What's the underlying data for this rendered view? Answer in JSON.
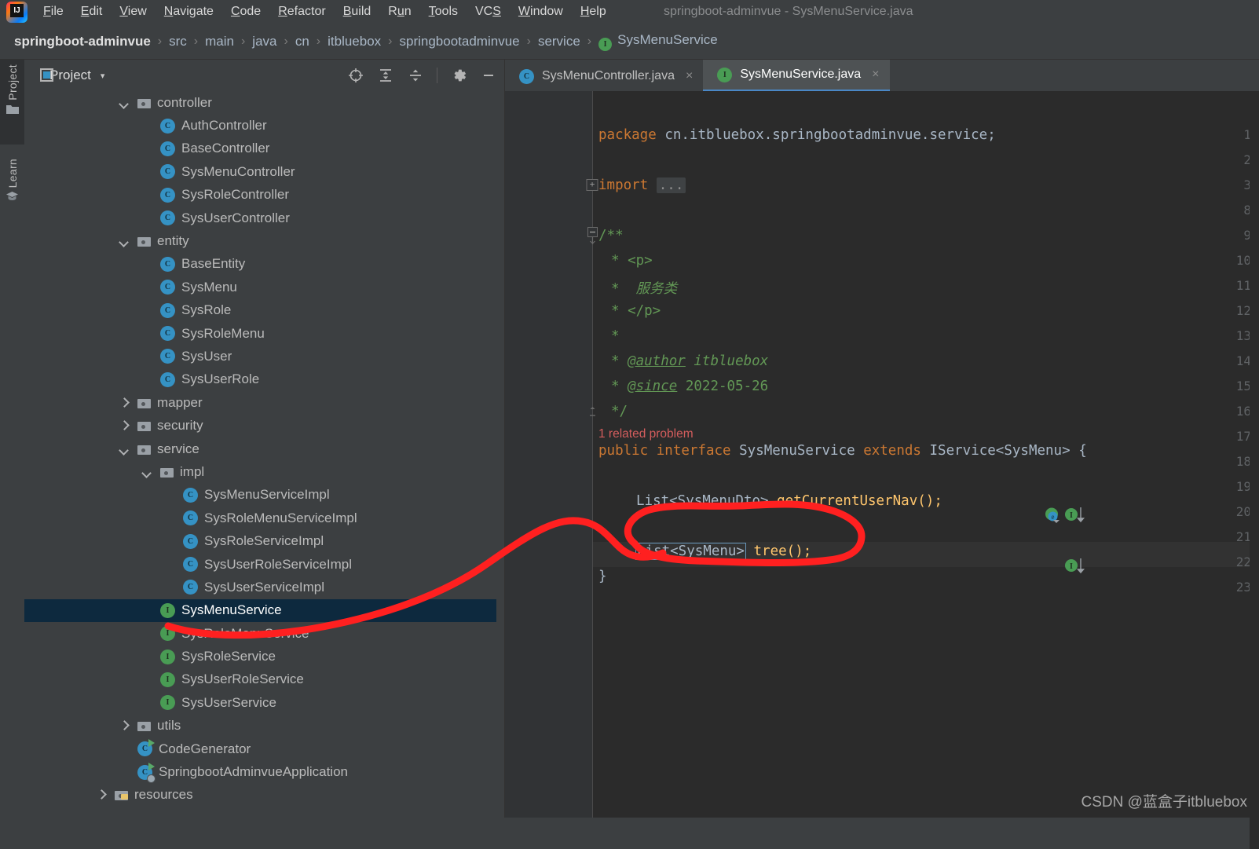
{
  "window": {
    "title": "springboot-adminvue - SysMenuService.java",
    "logo_text": "IJ",
    "logo_name": "intellij-idea-logo"
  },
  "menubar": {
    "items": [
      {
        "label": "File",
        "mnemonic": "F"
      },
      {
        "label": "Edit",
        "mnemonic": "E"
      },
      {
        "label": "View",
        "mnemonic": "V"
      },
      {
        "label": "Navigate",
        "mnemonic": "N"
      },
      {
        "label": "Code",
        "mnemonic": "C"
      },
      {
        "label": "Refactor",
        "mnemonic": "R"
      },
      {
        "label": "Build",
        "mnemonic": "B"
      },
      {
        "label": "Run",
        "mnemonic": "u"
      },
      {
        "label": "Tools",
        "mnemonic": "T"
      },
      {
        "label": "VCS",
        "mnemonic": "S"
      },
      {
        "label": "Window",
        "mnemonic": "W"
      },
      {
        "label": "Help",
        "mnemonic": "H"
      }
    ]
  },
  "breadcrumb": {
    "separator": "›",
    "items": [
      {
        "label": "springboot-adminvue",
        "icon": null
      },
      {
        "label": "src",
        "icon": null
      },
      {
        "label": "main",
        "icon": null
      },
      {
        "label": "java",
        "icon": null
      },
      {
        "label": "cn",
        "icon": null
      },
      {
        "label": "itbluebox",
        "icon": null
      },
      {
        "label": "springbootadminvue",
        "icon": null
      },
      {
        "label": "service",
        "icon": null
      },
      {
        "label": "SysMenuService",
        "icon": "I"
      }
    ]
  },
  "rail": {
    "buttons": [
      {
        "label": "Project",
        "icon": "folder-icon",
        "active": true
      },
      {
        "label": "Learn",
        "icon": "graduation-cap-icon",
        "active": false
      }
    ]
  },
  "project_panel": {
    "title": "Project",
    "caret": "▾",
    "toolbar_icons": [
      {
        "name": "locate-target-icon",
        "title": "Select Opened File"
      },
      {
        "name": "expand-all-icon",
        "title": "Expand All"
      },
      {
        "name": "collapse-all-icon",
        "title": "Collapse All"
      },
      {
        "name": "gear-icon",
        "title": "Options"
      },
      {
        "name": "minimize-icon",
        "title": "Hide"
      }
    ],
    "tree": [
      {
        "label": "controller",
        "type": "folder",
        "indent": 4,
        "arrow": "down"
      },
      {
        "label": "AuthController",
        "type": "class",
        "indent": 5,
        "arrow": "none"
      },
      {
        "label": "BaseController",
        "type": "class",
        "indent": 5,
        "arrow": "none"
      },
      {
        "label": "SysMenuController",
        "type": "class",
        "indent": 5,
        "arrow": "none"
      },
      {
        "label": "SysRoleController",
        "type": "class",
        "indent": 5,
        "arrow": "none"
      },
      {
        "label": "SysUserController",
        "type": "class",
        "indent": 5,
        "arrow": "none"
      },
      {
        "label": "entity",
        "type": "folder",
        "indent": 4,
        "arrow": "down"
      },
      {
        "label": "BaseEntity",
        "type": "class",
        "indent": 5,
        "arrow": "none"
      },
      {
        "label": "SysMenu",
        "type": "class",
        "indent": 5,
        "arrow": "none"
      },
      {
        "label": "SysRole",
        "type": "class",
        "indent": 5,
        "arrow": "none"
      },
      {
        "label": "SysRoleMenu",
        "type": "class",
        "indent": 5,
        "arrow": "none"
      },
      {
        "label": "SysUser",
        "type": "class",
        "indent": 5,
        "arrow": "none"
      },
      {
        "label": "SysUserRole",
        "type": "class",
        "indent": 5,
        "arrow": "none"
      },
      {
        "label": "mapper",
        "type": "folder",
        "indent": 4,
        "arrow": "right"
      },
      {
        "label": "security",
        "type": "folder",
        "indent": 4,
        "arrow": "right"
      },
      {
        "label": "service",
        "type": "folder",
        "indent": 4,
        "arrow": "down"
      },
      {
        "label": "impl",
        "type": "folder",
        "indent": 5,
        "arrow": "down"
      },
      {
        "label": "SysMenuServiceImpl",
        "type": "class",
        "indent": 6,
        "arrow": "none"
      },
      {
        "label": "SysRoleMenuServiceImpl",
        "type": "class",
        "indent": 6,
        "arrow": "none"
      },
      {
        "label": "SysRoleServiceImpl",
        "type": "class",
        "indent": 6,
        "arrow": "none"
      },
      {
        "label": "SysUserRoleServiceImpl",
        "type": "class",
        "indent": 6,
        "arrow": "none"
      },
      {
        "label": "SysUserServiceImpl",
        "type": "class",
        "indent": 6,
        "arrow": "none"
      },
      {
        "label": "SysMenuService",
        "type": "interface",
        "indent": 5,
        "arrow": "none",
        "selected": true
      },
      {
        "label": "SysRoleMenuService",
        "type": "interface",
        "indent": 5,
        "arrow": "none"
      },
      {
        "label": "SysRoleService",
        "type": "interface",
        "indent": 5,
        "arrow": "none"
      },
      {
        "label": "SysUserRoleService",
        "type": "interface",
        "indent": 5,
        "arrow": "none"
      },
      {
        "label": "SysUserService",
        "type": "interface",
        "indent": 5,
        "arrow": "none"
      },
      {
        "label": "utils",
        "type": "folder",
        "indent": 4,
        "arrow": "right"
      },
      {
        "label": "CodeGenerator",
        "type": "class-run",
        "indent": 4,
        "arrow": "none"
      },
      {
        "label": "SpringbootAdminvueApplication",
        "type": "class-runapp",
        "indent": 4,
        "arrow": "none"
      },
      {
        "label": "resources",
        "type": "folder-resources",
        "indent": 3,
        "arrow": "right"
      }
    ]
  },
  "editor": {
    "tabs": [
      {
        "label": "SysMenuController.java",
        "icon": "C",
        "active": false,
        "close": "×"
      },
      {
        "label": "SysMenuService.java",
        "icon": "I",
        "active": true,
        "close": "×"
      }
    ],
    "inspection_hint": "1 related problem",
    "line_numbers": [
      "1",
      "2",
      "3",
      "8",
      "9",
      "10",
      "11",
      "12",
      "13",
      "14",
      "15",
      "16",
      "17",
      "18",
      "19",
      "20",
      "21",
      "22",
      "23"
    ],
    "lines": [
      {
        "num": "1",
        "text": "package cn.itbluebox.springbootadminvue.service;"
      },
      {
        "num": "2",
        "text": ""
      },
      {
        "num": "3",
        "text": "import ..."
      },
      {
        "num": "8",
        "text": ""
      },
      {
        "num": "9",
        "text": "/**"
      },
      {
        "num": "10",
        "text": " * <p>"
      },
      {
        "num": "11",
        "text": " *  服务类"
      },
      {
        "num": "12",
        "text": " * </p>"
      },
      {
        "num": "13",
        "text": " *"
      },
      {
        "num": "14",
        "text": " * @author itbluebox"
      },
      {
        "num": "15",
        "text": " * @since 2022-05-26"
      },
      {
        "num": "16",
        "text": " */"
      },
      {
        "num": "17",
        "text": "public interface SysMenuService extends IService<SysMenu> {"
      },
      {
        "num": "18",
        "text": ""
      },
      {
        "num": "19",
        "text": "    List<SysMenuDto> getCurrentUserNav();"
      },
      {
        "num": "20",
        "text": ""
      },
      {
        "num": "21",
        "text": "    List<SysMenu> tree();"
      },
      {
        "num": "22",
        "text": "}"
      },
      {
        "num": "23",
        "text": ""
      }
    ],
    "tokens": {
      "package_kw": "package",
      "package_name": "cn.itbluebox.springbootadminvue.service",
      "import_kw": "import",
      "import_dots": "...",
      "javadoc_open": "/**",
      "javadoc_p_open": "* <p>",
      "javadoc_text": "*  服务类",
      "javadoc_p_close": "* </p>",
      "javadoc_blank": "*",
      "javadoc_author_tag": "@author",
      "javadoc_author_val": "itbluebox",
      "javadoc_since_tag": "@since",
      "javadoc_since_val": "2022-05-26",
      "javadoc_close": "*/",
      "public_kw": "public",
      "interface_kw": "interface",
      "iface_name": "SysMenuService",
      "extends_kw": "extends",
      "super_type": "IService<SysMenu>",
      "brace_open": "{",
      "m1_type": "List<SysMenuDto>",
      "m1_name": "getCurrentUserNav",
      "m1_tail": "();",
      "m2_type": "List<SysMenu>",
      "m2_name": "tree",
      "m2_tail": "();",
      "brace_close": "}"
    },
    "gutter_marks": [
      {
        "line": "17",
        "icons": [
          "implemented-icon",
          "override-down-icon"
        ]
      },
      {
        "line": "19",
        "icons": [
          "override-down-icon"
        ]
      }
    ]
  },
  "annotations": {
    "watermark": "CSDN @蓝盒子itbluebox",
    "ink_color": "#ff2020",
    "shapes": [
      "freehand-curve",
      "ellipse-circle"
    ]
  },
  "colors": {
    "editor_bg": "#2b2b2b",
    "panel_bg": "#3c3f41",
    "gutter_bg": "#313335",
    "selection_bg": "#0d293e",
    "keyword": "#cc7832",
    "comment": "#629755",
    "method": "#ffc66d",
    "text": "#a9b7c6",
    "error": "#d45d5d",
    "class_icon": "#3592c4",
    "interface_icon": "#499c54",
    "accent": "#4a88c7"
  }
}
